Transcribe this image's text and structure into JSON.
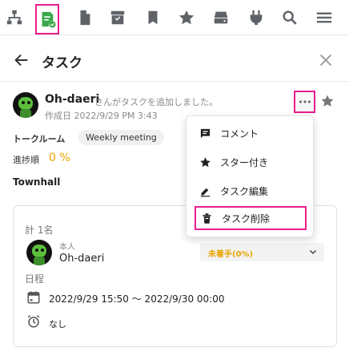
{
  "toolbar": {
    "icons": [
      "org-chart-icon",
      "task-icon",
      "file-icon",
      "archive-icon",
      "bookmark-icon",
      "star-icon",
      "storage-icon",
      "plugin-icon",
      "search-icon",
      "menu-icon"
    ],
    "active_icon": "task-icon"
  },
  "header": {
    "title": "タスク"
  },
  "post": {
    "author": "Oh-daeri",
    "action_text": "さんがタスクを追加しました。",
    "created": "作成日 2022/9/29 PM 3:43",
    "room_label": "トークルーム",
    "room_name": "Weekly meeting",
    "progress_label": "進捗順",
    "progress_value": "0 %",
    "task_title": "Townhall"
  },
  "assignees": {
    "count_label": "計 1名",
    "role": "本人",
    "name": "Oh-daeri",
    "status": "未着手(0%)"
  },
  "schedule": {
    "label": "日程",
    "date_range": "2022/9/29 15:50 ～ 2022/9/30 00:00",
    "reminder": "なし"
  },
  "menu": {
    "items": [
      {
        "label": "コメント",
        "icon": "comment-icon"
      },
      {
        "label": "スター付き",
        "icon": "star-icon"
      },
      {
        "label": "タスク編集",
        "icon": "edit-icon"
      },
      {
        "label": "タスク削除",
        "icon": "delete-icon"
      }
    ]
  },
  "colors": {
    "accent": "#3aa84a",
    "highlight": "#e91e8c",
    "progress": "#e8a300"
  }
}
